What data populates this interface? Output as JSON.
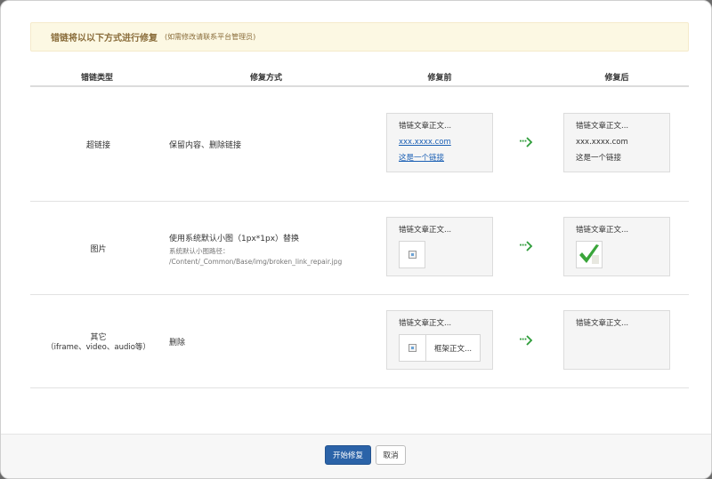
{
  "notice": {
    "main": "错链将以以下方式进行修复",
    "sub": "(如需修改请联系平台管理员)"
  },
  "table": {
    "headers": [
      "错链类型",
      "修复方式",
      "修复前",
      "修复后"
    ],
    "rows": [
      {
        "type": "超链接",
        "method": "保留内容、删除链接",
        "before": [
          "错链文章正文...",
          "xxx.xxxx.com",
          "这是一个链接"
        ],
        "after": [
          "错链文章正文...",
          "xxx.xxxx.com",
          "这是一个链接"
        ]
      },
      {
        "type": "图片",
        "method": "使用系统默认小图（1px*1px）替换",
        "method_note_label": "系统默认小图路径：",
        "method_note_path": "/Content/_Common/Base/img/broken_link_repair.jpg",
        "before": [
          "错链文章正文..."
        ],
        "after": [
          "错链文章正文..."
        ]
      },
      {
        "type": "其它",
        "type_sub": "（iframe、video、audio等）",
        "method": "删除",
        "before": [
          "错链文章正文...",
          "框架正文..."
        ],
        "after": [
          "错链文章正文..."
        ]
      }
    ]
  },
  "colors": {
    "notice_bg": "#fcf8e3",
    "notice_text": "#8a6d3b",
    "link": "#1a5fb4",
    "arrow": "#2e9c3a",
    "checkmark": "#3aa53a",
    "primary": "#2b63a8"
  },
  "icons": [
    "broken-image-icon",
    "arrow-right-icon",
    "checkmark-icon"
  ],
  "footer": {
    "start_label": "开始修复",
    "cancel_label": "取消"
  }
}
